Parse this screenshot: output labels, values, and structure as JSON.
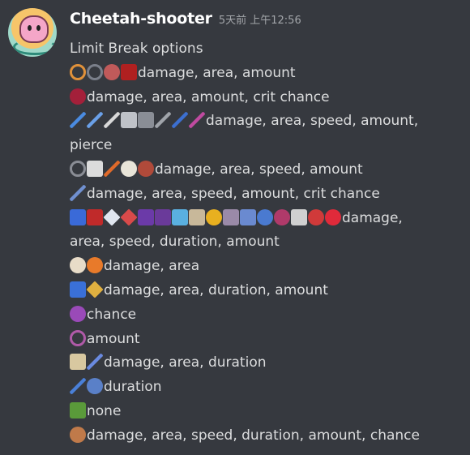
{
  "header": {
    "username": "Cheetah-shooter",
    "timestamp": "5天前 上午12:56"
  },
  "content": {
    "intro": "Limit Break options",
    "rows": [
      {
        "icons": [
          [
            "swirl-icon",
            "#e0913a",
            "ring"
          ],
          [
            "whip-icon",
            "#7a7f8a",
            "ring"
          ],
          [
            "dart-icon",
            "#c05a5a",
            "round"
          ],
          [
            "cape-icon",
            "#b02020",
            ""
          ]
        ],
        "text": "damage, area, amount"
      },
      {
        "icons": [
          [
            "crimson-orb-icon",
            "#a3203a",
            "round"
          ]
        ],
        "text": "damage, area, amount, crit chance"
      },
      {
        "icons": [
          [
            "blue-wand-icon",
            "#4a8be0",
            "stick"
          ],
          [
            "blue-staff-icon",
            "#6aa0e8",
            "stick"
          ],
          [
            "arrow-icon",
            "#d8d8d8",
            "stick"
          ],
          [
            "axe-icon",
            "#bfc2c8",
            ""
          ],
          [
            "scythe-icon",
            "#8a8e96",
            ""
          ],
          [
            "dagger-icon",
            "#a0a4aa",
            "stick"
          ],
          [
            "blue-blade-icon",
            "#3c6fd0",
            "stick"
          ],
          [
            "bow-icon",
            "#c04aa0",
            "stick"
          ]
        ],
        "text": "damage, area, speed, amount,"
      },
      {
        "icons": [],
        "text": "pierce"
      },
      {
        "icons": [
          [
            "boomerang-icon",
            "#8a8d95",
            "ring"
          ],
          [
            "cross-icon",
            "#dcdcdc",
            ""
          ],
          [
            "flame-axe-icon",
            "#e06a2a",
            "stick"
          ],
          [
            "skull-icon",
            "#e8e4d8",
            "round"
          ],
          [
            "wheel-icon",
            "#b04a3a",
            "round"
          ]
        ],
        "text": "damage, area, speed, amount"
      },
      {
        "icons": [
          [
            "sword-icon",
            "#7090d0",
            "stick"
          ]
        ],
        "text": "damage, area, speed, amount, crit chance"
      },
      {
        "icons": [
          [
            "tome-icon",
            "#3a6ad8",
            ""
          ],
          [
            "red-tome-icon",
            "#c02a2a",
            ""
          ],
          [
            "crystal-icon",
            "#e0e6f0",
            "diamond"
          ],
          [
            "diamond-icon",
            "#d84a4a",
            "diamond"
          ],
          [
            "bat-icon",
            "#6b3aa8",
            ""
          ],
          [
            "bat2-icon",
            "#6a3a9a",
            ""
          ],
          [
            "bird-icon",
            "#5ab0e0",
            ""
          ],
          [
            "claw-icon",
            "#c8b89a",
            ""
          ],
          [
            "gold-coin-icon",
            "#e8b020",
            "round"
          ],
          [
            "candle-icon",
            "#9a8aa8",
            ""
          ],
          [
            "hammer-icon",
            "#6a8ad0",
            ""
          ],
          [
            "blue-swirl-icon",
            "#4a7ad0",
            "round"
          ],
          [
            "gem-flower-icon",
            "#b03a6a",
            "round"
          ],
          [
            "key-icon",
            "#d0d0d0",
            ""
          ],
          [
            "rose-icon",
            "#d03a3a",
            "round"
          ],
          [
            "egg-icon",
            "#e02a3a",
            "round"
          ]
        ],
        "text": "damage,"
      },
      {
        "icons": [],
        "text": "area, speed, duration, amount"
      },
      {
        "icons": [
          [
            "garlic-icon",
            "#e8dcc8",
            "round"
          ],
          [
            "fireball-icon",
            "#e87a2a",
            "round"
          ]
        ],
        "text": "damage, area"
      },
      {
        "icons": [
          [
            "blue-potion-icon",
            "#3a70d8",
            ""
          ],
          [
            "yellow-potion-icon",
            "#e0b040",
            "diamond"
          ]
        ],
        "text": "damage, area, duration, amount"
      },
      {
        "icons": [
          [
            "purple-web-icon",
            "#9a4ab8",
            "round"
          ]
        ],
        "text": "chance"
      },
      {
        "icons": [
          [
            "target-icon",
            "#b05aa8",
            "ring"
          ]
        ],
        "text": "amount"
      },
      {
        "icons": [
          [
            "scroll-icon",
            "#d8c8a0",
            ""
          ],
          [
            "star-wand-icon",
            "#6a8ae0",
            "stick"
          ]
        ],
        "text": "damage, area, duration"
      },
      {
        "icons": [
          [
            "blue-rod-icon",
            "#4a80d8",
            "stick"
          ],
          [
            "blue-shield-icon",
            "#5a80c8",
            "round"
          ]
        ],
        "text": "duration"
      },
      {
        "icons": [
          [
            "plant-icon",
            "#5a9a3a",
            ""
          ]
        ],
        "text": "none"
      },
      {
        "icons": [
          [
            "clock-orb-icon",
            "#c07a4a",
            "round"
          ]
        ],
        "text": "damage, area, speed, duration, amount, chance"
      }
    ]
  }
}
